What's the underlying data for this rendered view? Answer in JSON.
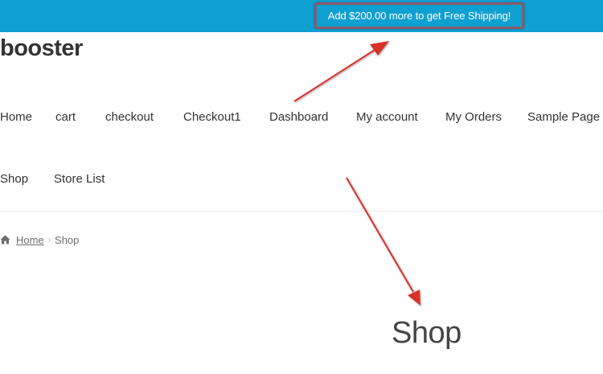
{
  "topbar": {
    "notice": "Add $200.00 more to get Free Shipping!",
    "background_color": "#0fa0d2",
    "highlight_border_color": "#8b5a6a"
  },
  "header": {
    "site_title": "booster"
  },
  "nav": {
    "items": [
      {
        "label": "Home"
      },
      {
        "label": "cart"
      },
      {
        "label": "checkout"
      },
      {
        "label": "Checkout1"
      },
      {
        "label": "Dashboard"
      },
      {
        "label": "My account"
      },
      {
        "label": "My Orders"
      },
      {
        "label": "Sample Page"
      },
      {
        "label": "Shop"
      },
      {
        "label": "Store List"
      }
    ]
  },
  "breadcrumb": {
    "icon": "home-icon",
    "home_label": "Home",
    "separator": "›",
    "current": "Shop"
  },
  "main": {
    "page_title": "Shop"
  },
  "annotations": {
    "arrow_color": "#d9302c"
  }
}
